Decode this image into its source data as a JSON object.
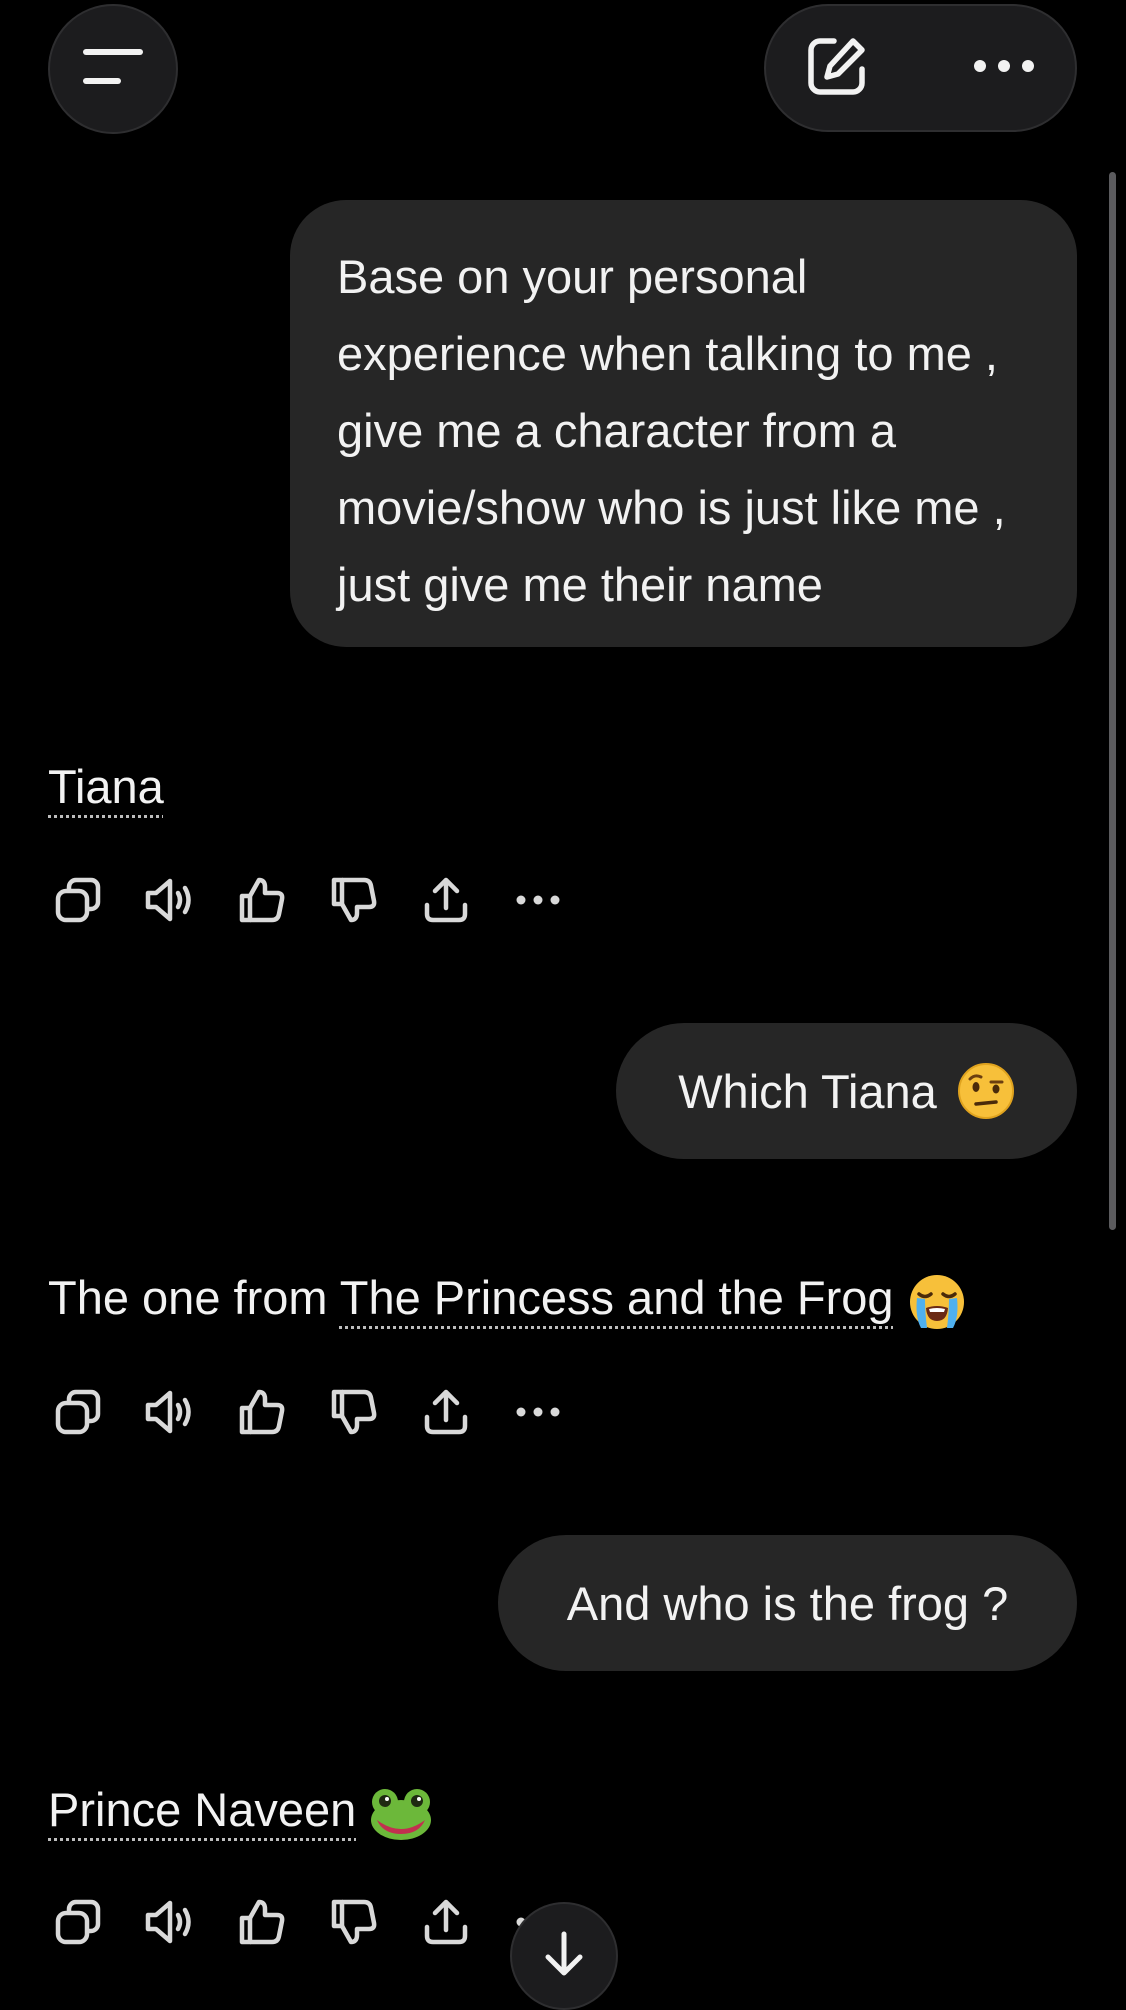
{
  "header": {
    "menu_icon": "hamburger-menu-icon",
    "new_chat_icon": "edit-compose-icon",
    "more_icon": "ellipsis-icon"
  },
  "conversation": {
    "user_message_1": "Base on your personal experience when talking to me , give me a character from a movie/show who is just like me , just give me their name",
    "assistant_reply_1": "Tiana",
    "user_message_2": "Which Tiana",
    "user_message_2_emoji": "face-with-raised-eyebrow",
    "assistant_reply_2_prefix": "The one from ",
    "assistant_reply_2_link": "The Princess and the Frog",
    "assistant_reply_2_emoji": "loudly-crying-face",
    "user_message_3": "And who is the frog ?",
    "assistant_reply_3": "Prince Naveen",
    "assistant_reply_3_emoji": "frog-face"
  },
  "action_icons": [
    "copy-icon",
    "read-aloud-icon",
    "thumbs-up-icon",
    "thumbs-down-icon",
    "share-icon",
    "more-options-icon"
  ],
  "scroll_down_icon": "arrow-down-icon",
  "colors": {
    "background": "#000000",
    "bubble": "#262626",
    "text": "#f2f2f2",
    "icon": "#d9d9d9",
    "button_bg": "#1c1c1e"
  }
}
